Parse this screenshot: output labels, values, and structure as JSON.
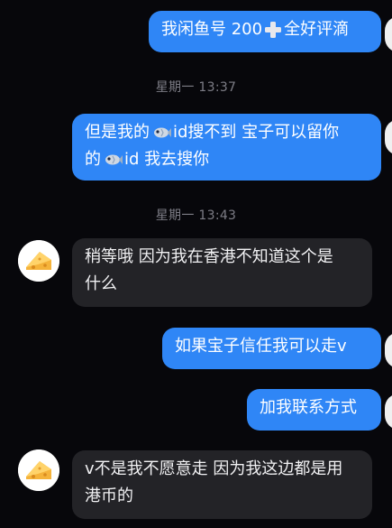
{
  "messages": [
    {
      "side": "out",
      "parts": [
        "我闲鱼号 200",
        "全好评滴"
      ]
    },
    {
      "timestamp": "星期一 13:37"
    },
    {
      "side": "out",
      "line1": [
        "但是我的",
        "id搜不到 宝子可以留你"
      ],
      "line2": [
        "的",
        "id 我去搜你"
      ]
    },
    {
      "timestamp": "星期一 13:43"
    },
    {
      "side": "in",
      "line1": "稍等哦 因为我在香港不知道这个是",
      "line2": "什么"
    },
    {
      "side": "out",
      "text": "如果宝子信任我可以走v"
    },
    {
      "side": "out",
      "text": "加我联系方式"
    },
    {
      "side": "in",
      "line1": "v不是我不愿意走 因为我这边都是用",
      "line2": "港币的"
    }
  ],
  "icons": {
    "fish": "fish-emoji-icon",
    "plus": "heavy-plus-icon",
    "avatar": "cheese-avatar-icon"
  },
  "colors": {
    "background": "#07070b",
    "outgoing_bubble": "#2f86f6",
    "incoming_bubble": "#232327",
    "timestamp": "#7d7d86"
  }
}
